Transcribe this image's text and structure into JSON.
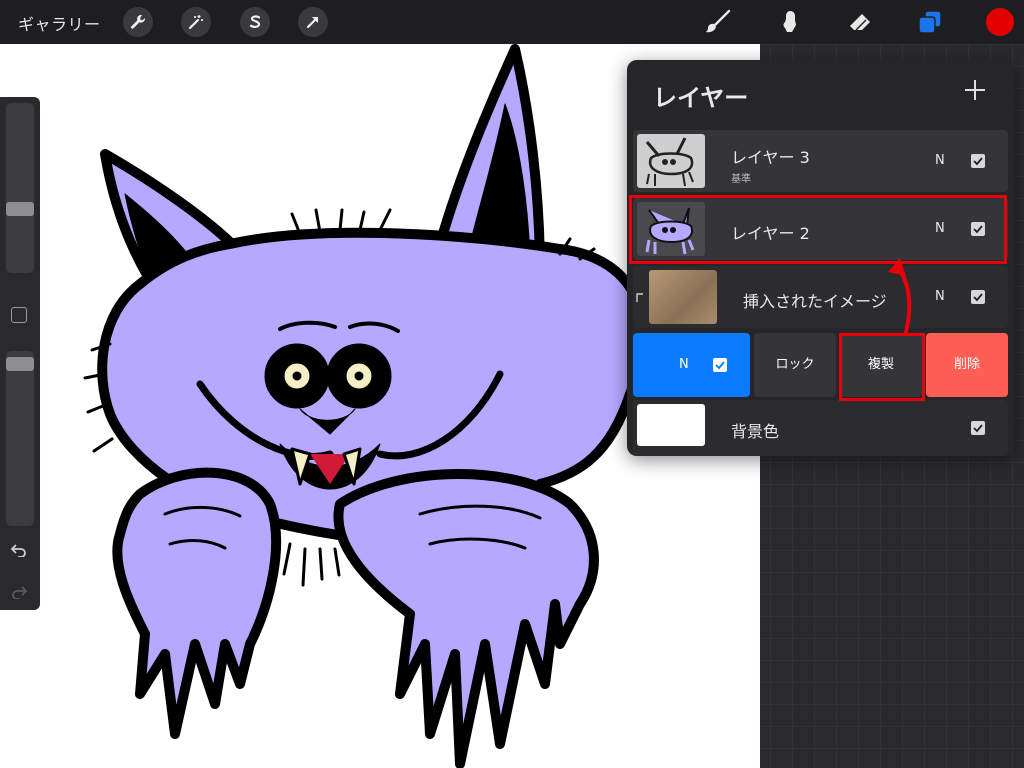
{
  "topbar": {
    "gallery_label": "ギャラリー",
    "left_tools": [
      "wrench-icon",
      "magic-wand-icon",
      "selection-s-icon",
      "transform-arrow-icon"
    ],
    "right_tools": [
      "brush-icon",
      "smudge-icon",
      "eraser-icon",
      "layers-icon"
    ],
    "current_color": "#e30000",
    "accent": "#1a73e8"
  },
  "sidebar": {
    "brush_size_level": 0.25,
    "opacity_level": 0.0,
    "undo_icon": "undo-icon",
    "redo_icon": "redo-icon"
  },
  "layers": {
    "title": "レイヤー",
    "add_icon": "plus-icon",
    "items": [
      {
        "name": "レイヤー 3",
        "sub": "基準",
        "blend": "N",
        "visible": true
      },
      {
        "name": "レイヤー 2",
        "sub": "",
        "blend": "N",
        "visible": true
      },
      {
        "name": "挿入されたイメージ",
        "sub": "",
        "blend": "N",
        "visible": true
      },
      {
        "name": "背景色",
        "sub": "",
        "blend": "",
        "visible": true
      }
    ],
    "actions": {
      "blend_label": "N",
      "lock_label": "ロック",
      "duplicate_label": "複製",
      "delete_label": "削除"
    },
    "colors": {
      "blend_button": "#0a7bff",
      "delete_button": "#ff5e55",
      "highlight": "#e8000b"
    }
  }
}
